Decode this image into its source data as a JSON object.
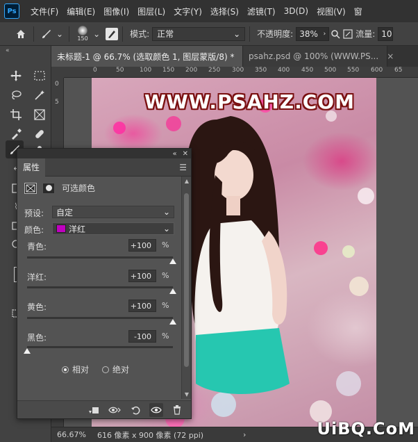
{
  "app": {
    "logo": "Ps"
  },
  "menu": [
    "文件(F)",
    "编辑(E)",
    "图像(I)",
    "图层(L)",
    "文字(Y)",
    "选择(S)",
    "滤镜(T)",
    "3D(D)",
    "视图(V)",
    "窗"
  ],
  "options": {
    "brush_size": "150",
    "mode_label": "模式:",
    "mode_value": "正常",
    "opacity_label": "不透明度:",
    "opacity_value": "38%",
    "flow_label": "流量:",
    "flow_value": "10"
  },
  "tabs": [
    {
      "title": "未标题-1 @ 66.7% (选取颜色 1, 图层蒙版/8) *",
      "close": "×"
    },
    {
      "title": "psahz.psd @ 100% (WWW.PS...",
      "close": "×"
    }
  ],
  "ruler": {
    "top_ticks": [
      "0",
      "50",
      "100",
      "150",
      "200",
      "250",
      "300",
      "350",
      "400",
      "450",
      "500",
      "550",
      "600",
      "65"
    ],
    "left_ticks": [
      "0",
      "5"
    ]
  },
  "canvas": {
    "watermark": "WWW.PSAHZ.COM"
  },
  "status": {
    "zoom": "66.67%",
    "doc_size": "616 像素 x 900 像素 (72 ppi)",
    "arrow": "›"
  },
  "corner_watermark": "UiBQ.CoM",
  "properties": {
    "tab": "属性",
    "adjustment_title": "可选颜色",
    "preset_label": "预设:",
    "preset_value": "自定",
    "colors_label": "颜色:",
    "colors_value": "洋红",
    "swatch_color": "#c000c0",
    "sliders": [
      {
        "label": "青色:",
        "value": "+100",
        "unit": "%",
        "level": 1.0
      },
      {
        "label": "洋红:",
        "value": "+100",
        "unit": "%",
        "level": 1.0
      },
      {
        "label": "黄色:",
        "value": "+100",
        "unit": "%",
        "level": 1.0
      },
      {
        "label": "黑色:",
        "value": "-100",
        "unit": "%",
        "level": 0.0
      }
    ],
    "method": {
      "relative": "相对",
      "absolute": "绝对",
      "selected": "relative"
    }
  }
}
